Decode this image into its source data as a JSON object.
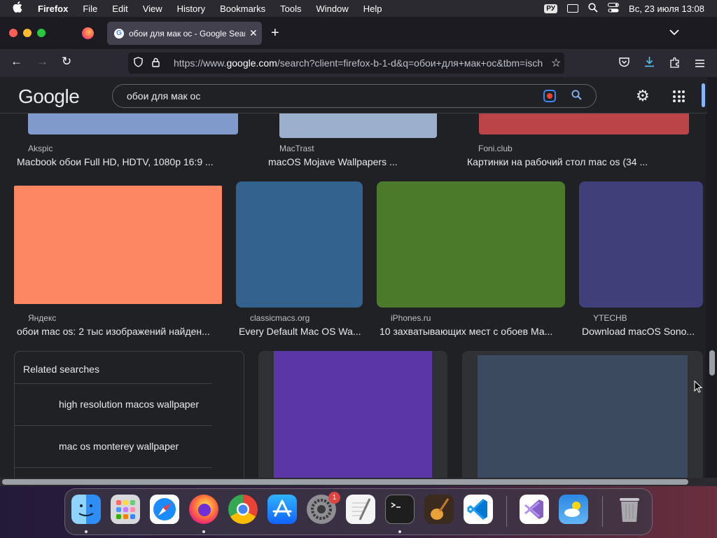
{
  "menubar": {
    "apple_icon": "",
    "items": [
      "Firefox",
      "File",
      "Edit",
      "View",
      "History",
      "Bookmarks",
      "Tools",
      "Window",
      "Help"
    ],
    "input_language": "РУ",
    "datetime": "Вс, 23 июля  13:08"
  },
  "tab": {
    "title": "обои для мак ос - Google Search",
    "favicon": "G",
    "close_glyph": "✕"
  },
  "newtab_glyph": "+",
  "tablist_glyph": "⌄",
  "nav": {
    "back": "←",
    "forward": "→",
    "reload": "↻"
  },
  "urlbar": {
    "url_prefix": "https://www.",
    "url_domain": "google.com",
    "url_rest": "/search?client=firefox-b-1-d&q=обои+для+мак+ос&tbm=isch",
    "star": "☆"
  },
  "google": {
    "logo": "Google",
    "query": "обои для мак ос",
    "settings_icon": "⚙"
  },
  "results_row1": [
    {
      "source": "Akspic",
      "caption": "Macbook обои Full HD, HDTV, 1080p 16:9 ...",
      "color": "#7f9acb"
    },
    {
      "source": "MacTrast",
      "caption": "macOS Mojave Wallpapers ...",
      "color": "#9cb0cd"
    },
    {
      "source": "Foni.club",
      "caption": "Картинки на рабочий стол mac os (34 ...",
      "color": "#bb4449"
    }
  ],
  "results_row2": [
    {
      "source": "Яндекс",
      "caption": "обои mac os: 2 тыс изображений найден...",
      "color": "#fd8763"
    },
    {
      "source": "classicmacs.org",
      "caption": "Every Default Mac OS Wa...",
      "color": "#34628f"
    },
    {
      "source": "iPhones.ru",
      "caption": "10 захватывающих мест с обоев Ма...",
      "color": "#4b7a2b"
    },
    {
      "source": "YTECHB",
      "caption": "Download macOS Sono...",
      "color": "#403f79"
    }
  ],
  "related": {
    "heading": "Related searches",
    "items": [
      "high resolution macos wallpaper",
      "mac os monterey wallpaper"
    ]
  },
  "row3_colors": [
    "#5b36a6",
    "#3c4a5f"
  ],
  "dock": {
    "apps": [
      "Finder",
      "Launchpad",
      "Safari",
      "Firefox",
      "Google Chrome",
      "App Store",
      "System Settings",
      "TextEdit",
      "Terminal",
      "GarageBand",
      "Visual Studio Code",
      "Visual Studio",
      "Weather",
      "Trash"
    ],
    "settings_badge": "1"
  },
  "colors": {
    "accent": "#8ab4f8",
    "page_bg": "#202124"
  }
}
